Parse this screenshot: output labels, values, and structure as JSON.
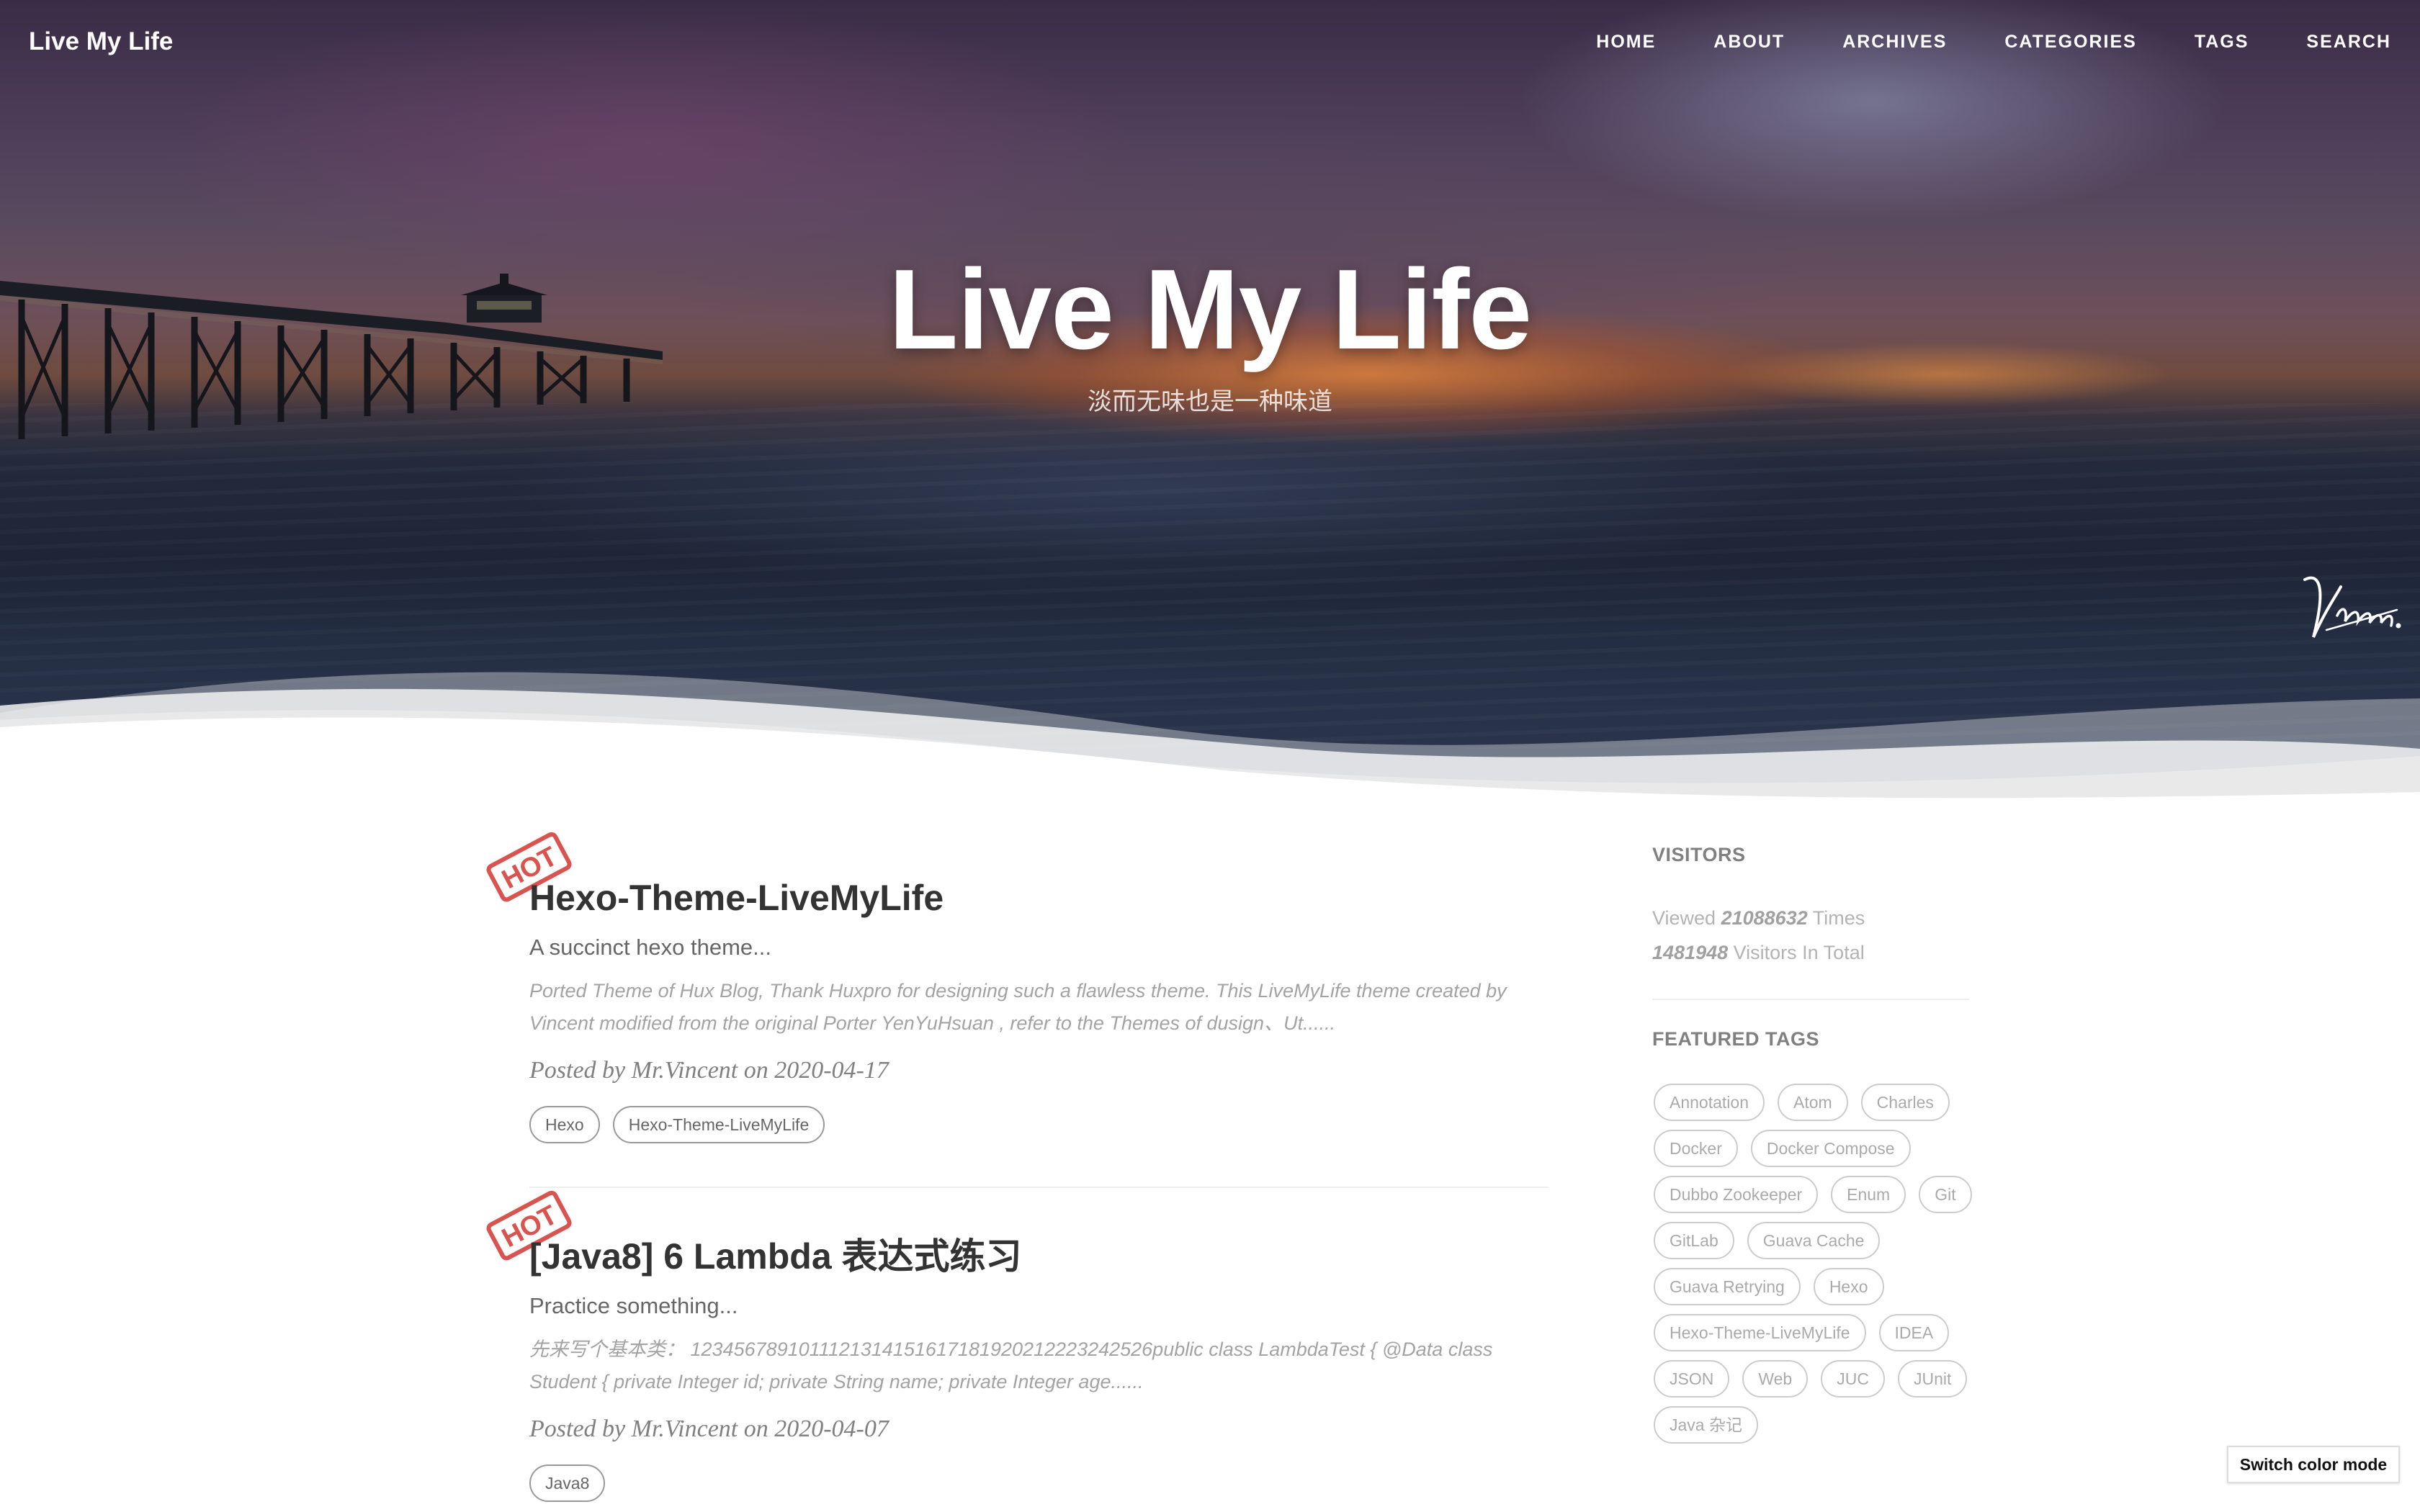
{
  "nav": {
    "brand": "Live My Life",
    "items": [
      "HOME",
      "ABOUT",
      "ARCHIVES",
      "CATEGORIES",
      "TAGS",
      "SEARCH"
    ]
  },
  "hero": {
    "title": "Live My Life",
    "subtitle": "淡而无味也是一种味道",
    "signature": "Vincent."
  },
  "posts": [
    {
      "badge": "HOT",
      "title": "Hexo-Theme-LiveMyLife",
      "subtitle": "A succinct hexo theme...",
      "excerpt": "Ported Theme of Hux Blog, Thank Huxpro for designing such a flawless theme. This LiveMyLife theme created by Vincent modified from the original Porter YenYuHsuan , refer to the Themes of dusign、Ut......",
      "meta": "Posted by Mr.Vincent on 2020-04-17",
      "tags": [
        "Hexo",
        "Hexo-Theme-LiveMyLife"
      ]
    },
    {
      "badge": "HOT",
      "title": "[Java8] 6 Lambda 表达式练习",
      "subtitle": "Practice something...",
      "excerpt": "先来写个基本类： 1234567891011121314151617181920212223242526public class LambdaTest { @Data class Student { private Integer id; private String name; private Integer age......",
      "meta": "Posted by Mr.Vincent on 2020-04-07",
      "tags": [
        "Java8"
      ]
    }
  ],
  "sidebar": {
    "visitors_heading": "VISITORS",
    "viewed_prefix": "Viewed ",
    "viewed_count": "21088632",
    "viewed_suffix": " Times",
    "visitors_count": "1481948",
    "visitors_suffix": " Visitors In Total",
    "featured_heading": "FEATURED TAGS",
    "featured_tags": [
      "Annotation",
      "Atom",
      "Charles",
      "Docker",
      "Docker Compose",
      "Dubbo Zookeeper",
      "Enum",
      "Git",
      "GitLab",
      "Guava Cache",
      "Guava Retrying",
      "Hexo",
      "Hexo-Theme-LiveMyLife",
      "IDEA",
      "JSON",
      "Web",
      "JUC",
      "JUnit",
      "Java 杂记"
    ]
  },
  "switch_mode_label": "Switch color mode",
  "colors": {
    "badge_red": "#d9534f",
    "text_dark": "#333333",
    "text_muted": "#a3a3a3"
  }
}
